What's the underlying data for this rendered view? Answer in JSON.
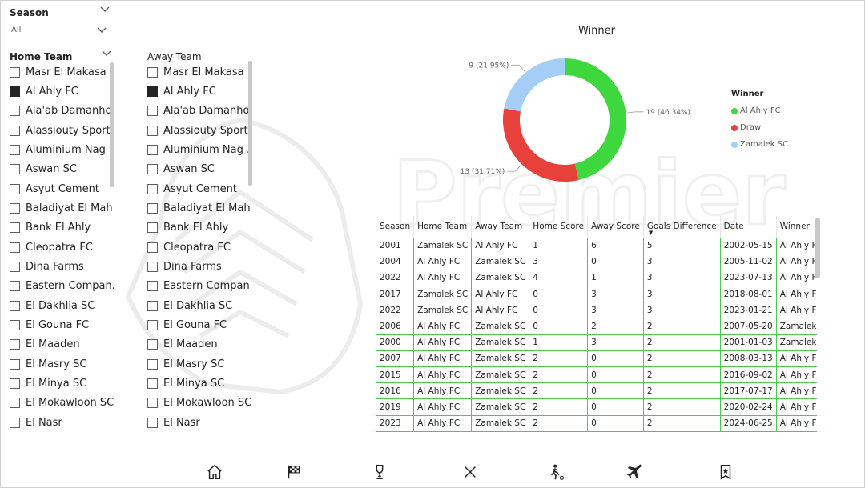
{
  "season_slicer": {
    "title": "Season",
    "value": "All"
  },
  "home_slicer": {
    "title": "Home Team",
    "items": [
      {
        "label": "Masr El Makasa",
        "checked": false
      },
      {
        "label": "Al Ahly FC",
        "checked": true
      },
      {
        "label": "Ala'ab Damanhour",
        "checked": false
      },
      {
        "label": "Alassiouty Sport",
        "checked": false
      },
      {
        "label": "Aluminium Nag ...",
        "checked": false
      },
      {
        "label": "Aswan SC",
        "checked": false
      },
      {
        "label": "Asyut Cement",
        "checked": false
      },
      {
        "label": "Baladiyat El Mah...",
        "checked": false
      },
      {
        "label": "Bank El Ahly",
        "checked": false
      },
      {
        "label": "Cleopatra FC",
        "checked": false
      },
      {
        "label": "Dina Farms",
        "checked": false
      },
      {
        "label": "Eastern Compan...",
        "checked": false
      },
      {
        "label": "El Dakhlia SC",
        "checked": false
      },
      {
        "label": "El Gouna FC",
        "checked": false
      },
      {
        "label": "El Maaden",
        "checked": false
      },
      {
        "label": "El Masry SC",
        "checked": false
      },
      {
        "label": "El Minya SC",
        "checked": false
      },
      {
        "label": "El Mokawloon SC",
        "checked": false
      },
      {
        "label": "El Nasr",
        "checked": false
      }
    ]
  },
  "away_slicer": {
    "title": "Away Team",
    "items": [
      {
        "label": "Masr El Makasa",
        "checked": false
      },
      {
        "label": "Al Ahly FC",
        "checked": true
      },
      {
        "label": "Ala'ab Damanhour",
        "checked": false
      },
      {
        "label": "Alassiouty Sport",
        "checked": false
      },
      {
        "label": "Aluminium Nag ...",
        "checked": false
      },
      {
        "label": "Aswan SC",
        "checked": false
      },
      {
        "label": "Asyut Cement",
        "checked": false
      },
      {
        "label": "Baladiyat El Mah...",
        "checked": false
      },
      {
        "label": "Bank El Ahly",
        "checked": false
      },
      {
        "label": "Cleopatra FC",
        "checked": false
      },
      {
        "label": "Dina Farms",
        "checked": false
      },
      {
        "label": "Eastern Compan...",
        "checked": false
      },
      {
        "label": "El Dakhlia SC",
        "checked": false
      },
      {
        "label": "El Gouna FC",
        "checked": false
      },
      {
        "label": "El Maaden",
        "checked": false
      },
      {
        "label": "El Masry SC",
        "checked": false
      },
      {
        "label": "El Minya SC",
        "checked": false
      },
      {
        "label": "El Mokawloon SC",
        "checked": false
      },
      {
        "label": "El Nasr",
        "checked": false
      }
    ]
  },
  "chart_data": {
    "type": "pie",
    "title": "Winner",
    "legend_title": "Winner",
    "legend_position": "right",
    "series": [
      {
        "name": "Al Ahly FC",
        "value": 19,
        "percent_label": "19 (46.34%)",
        "color": "#3ed83e"
      },
      {
        "name": "Draw",
        "value": 13,
        "percent_label": "13 (31.71%)",
        "color": "#e8413c"
      },
      {
        "name": "Zamalek SC",
        "value": 9,
        "percent_label": "9 (21.95%)",
        "color": "#a4cef5"
      }
    ]
  },
  "table": {
    "columns": [
      "Season",
      "Home Team",
      "Away Team",
      "Home Score",
      "Away Score",
      "Goals Difference",
      "Date",
      "Winner"
    ],
    "sorted_column": "Goals Difference",
    "rows": [
      [
        "2001",
        "Zamalek SC",
        "Al Ahly FC",
        "1",
        "6",
        "5",
        "2002-05-15",
        "Al Ahly FC"
      ],
      [
        "2004",
        "Al Ahly FC",
        "Zamalek SC",
        "3",
        "0",
        "3",
        "2005-11-02",
        "Al Ahly FC"
      ],
      [
        "2022",
        "Al Ahly FC",
        "Zamalek SC",
        "4",
        "1",
        "3",
        "2023-07-13",
        "Al Ahly FC"
      ],
      [
        "2017",
        "Zamalek SC",
        "Al Ahly FC",
        "0",
        "3",
        "3",
        "2018-08-01",
        "Al Ahly FC"
      ],
      [
        "2022",
        "Zamalek SC",
        "Al Ahly FC",
        "0",
        "3",
        "3",
        "2023-01-21",
        "Al Ahly FC"
      ],
      [
        "2006",
        "Al Ahly FC",
        "Zamalek SC",
        "0",
        "2",
        "2",
        "2007-05-20",
        "Zamalek SC"
      ],
      [
        "2000",
        "Al Ahly FC",
        "Zamalek SC",
        "1",
        "3",
        "2",
        "2001-01-03",
        "Zamalek SC"
      ],
      [
        "2007",
        "Al Ahly FC",
        "Zamalek SC",
        "2",
        "0",
        "2",
        "2008-03-13",
        "Al Ahly FC"
      ],
      [
        "2015",
        "Al Ahly FC",
        "Zamalek SC",
        "2",
        "0",
        "2",
        "2016-09-02",
        "Al Ahly FC"
      ],
      [
        "2016",
        "Al Ahly FC",
        "Zamalek SC",
        "2",
        "0",
        "2",
        "2017-07-17",
        "Al Ahly FC"
      ],
      [
        "2019",
        "Al Ahly FC",
        "Zamalek SC",
        "2",
        "0",
        "2",
        "2020-02-24",
        "Al Ahly FC"
      ],
      [
        "2023",
        "Al Ahly FC",
        "Zamalek SC",
        "2",
        "0",
        "2",
        "2024-06-25",
        "Al Ahly FC"
      ]
    ]
  },
  "watermark": {
    "text": "Premier"
  },
  "nav": [
    {
      "icon": "home-icon"
    },
    {
      "icon": "checkered-flag-icon"
    },
    {
      "icon": "trophy-icon"
    },
    {
      "icon": "close-icon"
    },
    {
      "icon": "player-icon"
    },
    {
      "icon": "airplane-icon"
    },
    {
      "icon": "bookmark-star-icon"
    }
  ],
  "colors": {
    "grid_green": "#4fc84f",
    "text": "#252423"
  }
}
